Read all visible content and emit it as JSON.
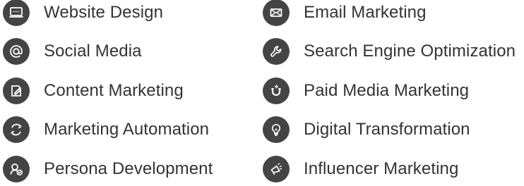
{
  "services": {
    "left": [
      {
        "label": "Website Design",
        "icon": "website-icon"
      },
      {
        "label": "Social Media",
        "icon": "at-sign-icon"
      },
      {
        "label": "Content Marketing",
        "icon": "pencil-document-icon"
      },
      {
        "label": "Marketing Automation",
        "icon": "refresh-arrows-icon"
      },
      {
        "label": "Persona Development",
        "icon": "persona-check-icon"
      }
    ],
    "right": [
      {
        "label": "Email Marketing",
        "icon": "envelope-icon"
      },
      {
        "label": "Search Engine Optimization",
        "icon": "wrench-icon"
      },
      {
        "label": "Paid Media Marketing",
        "icon": "magnet-icon"
      },
      {
        "label": "Digital Transformation",
        "icon": "lightbulb-icon"
      },
      {
        "label": "Influencer Marketing",
        "icon": "megaphone-icon"
      }
    ]
  },
  "colors": {
    "icon_background": "#444444",
    "icon_foreground": "#ffffff",
    "text": "#333333",
    "page_background": "#ffffff"
  }
}
